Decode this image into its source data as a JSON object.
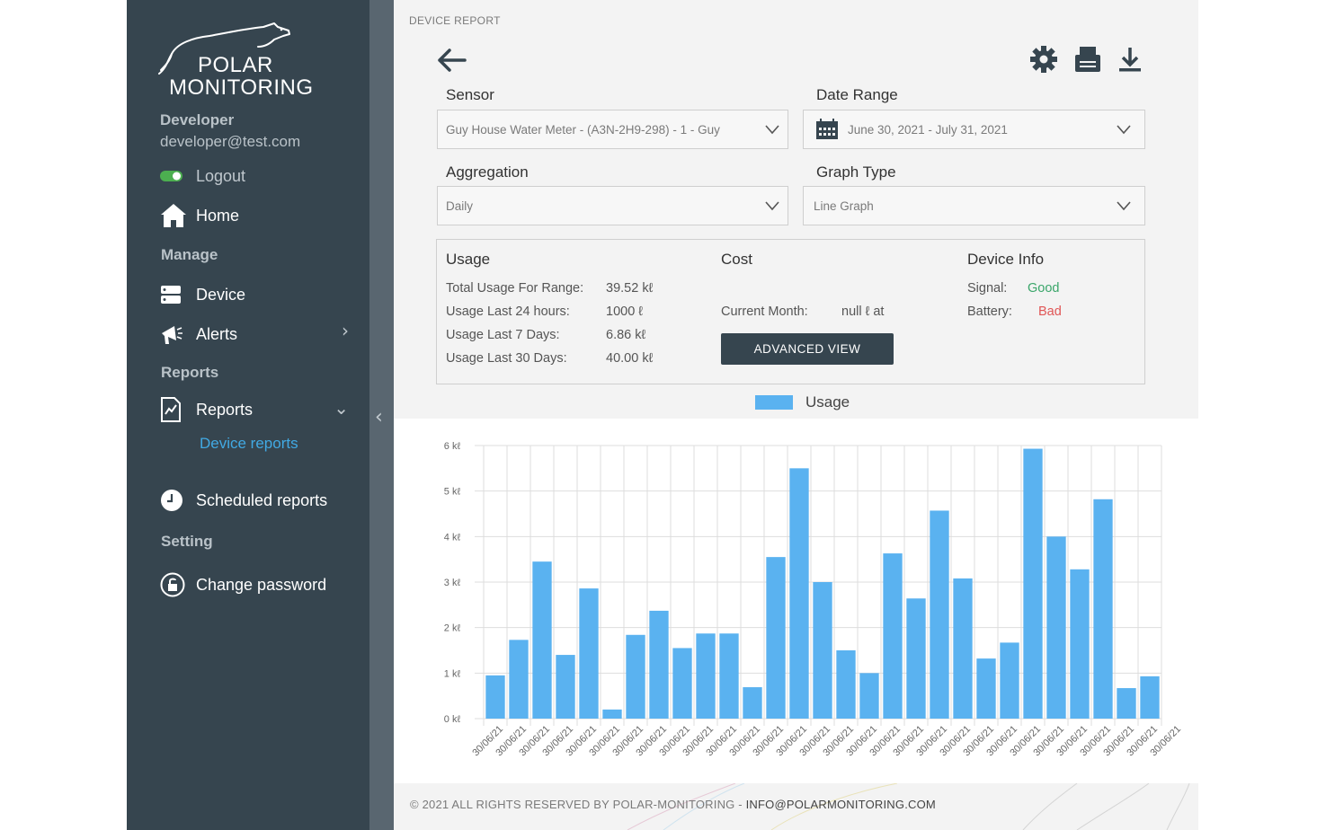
{
  "sidebar": {
    "brand": {
      "line1": "POLAR",
      "line2": "MONITORING"
    },
    "user": {
      "name": "Developer",
      "email": "developer@test.com"
    },
    "logout_label": "Logout",
    "home_label": "Home",
    "sections": {
      "manage": "Manage",
      "reports": "Reports",
      "setting": "Setting"
    },
    "items": {
      "device": "Device",
      "alerts": "Alerts",
      "reports": "Reports",
      "device_reports": "Device reports",
      "scheduled_reports": "Scheduled reports",
      "change_password": "Change password"
    },
    "colors": {
      "background": "#36454f",
      "active_link": "#41a9e3"
    }
  },
  "header": {
    "page_label": "DEVICE REPORT"
  },
  "toolbar": {
    "icons": [
      "gear-icon",
      "print-icon",
      "download-icon"
    ]
  },
  "filters": {
    "sensor": {
      "label": "Sensor",
      "value": "Guy House Water Meter - (A3N-2H9-298) - 1 - Guy"
    },
    "date_range": {
      "label": "Date Range",
      "value": "June 30, 2021 - July 31, 2021"
    },
    "aggregation": {
      "label": "Aggregation",
      "value": "Daily"
    },
    "graph_type": {
      "label": "Graph Type",
      "value": "Line Graph"
    }
  },
  "usage": {
    "title": "Usage",
    "rows": [
      {
        "label": "Total Usage For Range:",
        "value": "39.52 kℓ"
      },
      {
        "label": "Usage Last 24 hours:",
        "value": "1000 ℓ"
      },
      {
        "label": "Usage Last 7 Days:",
        "value": "6.86 kℓ"
      },
      {
        "label": "Usage Last 30 Days:",
        "value": "40.00 kℓ"
      }
    ]
  },
  "cost": {
    "title": "Cost",
    "current_month_label": "Current Month:",
    "current_month_value": "null ℓ at",
    "advanced_button": "ADVANCED VIEW"
  },
  "device_info": {
    "title": "Device Info",
    "signal_label": "Signal:",
    "signal_value": "Good",
    "battery_label": "Battery:",
    "battery_value": "Bad",
    "colors": {
      "good": "#3aa66a",
      "bad": "#e05555"
    }
  },
  "chart_data": {
    "type": "bar",
    "legend": [
      "Usage"
    ],
    "legend_position": "top-center",
    "grid": true,
    "bar_color": "#5ab2f0",
    "y_unit": "kℓ",
    "ylim": [
      0,
      6
    ],
    "y_ticks": [
      "0 kℓ",
      "1 kℓ",
      "2 kℓ",
      "3 kℓ",
      "4 kℓ",
      "5 kℓ",
      "6 kℓ"
    ],
    "categories": [
      "30/06/21",
      "30/06/21",
      "30/06/21",
      "30/06/21",
      "30/06/21",
      "30/06/21",
      "30/06/21",
      "30/06/21",
      "30/06/21",
      "30/06/21",
      "30/06/21",
      "30/06/21",
      "30/06/21",
      "30/06/21",
      "30/06/21",
      "30/06/21",
      "30/06/21",
      "30/06/21",
      "30/06/21",
      "30/06/21",
      "30/06/21",
      "30/06/21",
      "30/06/21",
      "30/06/21",
      "30/06/21",
      "30/06/21",
      "30/06/21",
      "30/06/21",
      "30/06/21",
      "30/06/21"
    ],
    "series": [
      {
        "name": "Usage",
        "values": [
          0.95,
          1.73,
          3.45,
          1.4,
          2.86,
          0.2,
          1.84,
          2.37,
          1.55,
          1.87,
          1.87,
          0.69,
          3.55,
          5.5,
          3.0,
          1.5,
          1.0,
          3.63,
          2.64,
          4.57,
          3.08,
          1.32,
          1.67,
          5.93,
          4.0,
          3.28,
          4.82,
          0.67,
          0.93
        ]
      }
    ]
  },
  "footer": {
    "text": "© 2021 ALL RIGHTS RESERVED BY POLAR-MONITORING - ",
    "email": "INFO@POLARMONITORING.COM"
  }
}
